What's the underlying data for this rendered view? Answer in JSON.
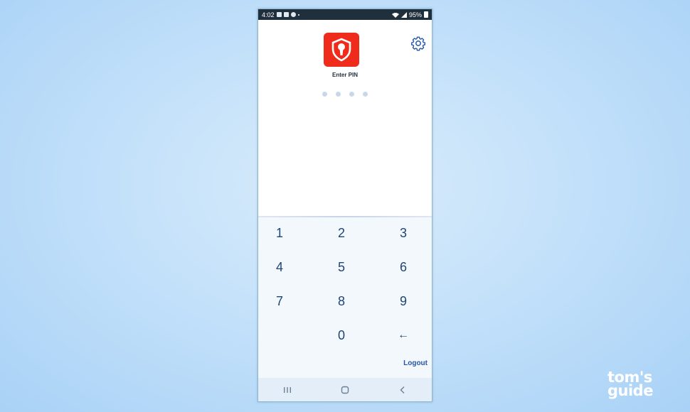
{
  "status_bar": {
    "time": "4:02",
    "battery": "95%"
  },
  "header": {
    "app_icon": "shield-keyhole-icon",
    "settings_icon": "gear-icon",
    "prompt": "Enter PIN",
    "pin_dot_count": 4
  },
  "keypad": {
    "keys": [
      "1",
      "2",
      "3",
      "4",
      "5",
      "6",
      "7",
      "8",
      "9",
      "0"
    ],
    "backspace_icon": "backspace-arrow-icon",
    "backspace_label": "←"
  },
  "footer": {
    "logout_label": "Logout"
  },
  "navigation_bar": {
    "recents_icon": "recents-icon",
    "home_icon": "home-icon",
    "back_icon": "back-icon"
  },
  "watermark": {
    "line1": "tom's",
    "line2": "guide"
  },
  "colors": {
    "accent": "#2456a8",
    "key_text": "#1e4478",
    "app_icon_bg": "#ef2b1c",
    "pin_dot": "#c9d7eb"
  }
}
